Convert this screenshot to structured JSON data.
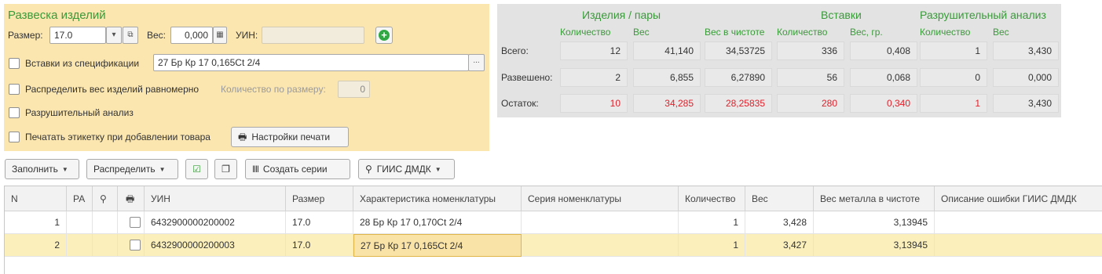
{
  "panel": {
    "title": "Развеска изделий",
    "size_label": "Размер:",
    "size_value": "17.0",
    "weight_label": "Вес:",
    "weight_value": "0,000",
    "uin_label": "УИН:",
    "uin_value": "",
    "inserts_label": "Вставки из спецификации",
    "inserts_value": "27 Бр Кр 17 0,165Ct 2/4",
    "browse_button": "...",
    "distribute_label": "Распределить вес изделий равномерно",
    "qty_by_size_label": "Количество по размеру:",
    "qty_by_size_value": "0",
    "destructive_label": "Разрушительный анализ",
    "print_label_label": "Печатать этикетку при добавлении товара",
    "print_settings_button": "Настройки печати"
  },
  "summary": {
    "group_items": "Изделия / пары",
    "group_inserts": "Вставки",
    "group_destructive": "Разрушительный анализ",
    "sub_qty": "Количество",
    "sub_weight": "Вес",
    "sub_pure": "Вес в чистоте",
    "sub_ins_qty": "Количество",
    "sub_ins_weight": "Вес, гр.",
    "sub_d_qty": "Количество",
    "sub_d_weight": "Вес",
    "rows": [
      {
        "label": "Всего:",
        "values": [
          "12",
          "41,140",
          "34,53725",
          "336",
          "0,408",
          "1",
          "3,430"
        ]
      },
      {
        "label": "Развешено:",
        "values": [
          "2",
          "6,855",
          "6,27890",
          "56",
          "0,068",
          "0",
          "0,000"
        ]
      },
      {
        "label": "Остаток:",
        "values": [
          "10",
          "34,285",
          "28,25835",
          "280",
          "0,340",
          "1",
          "3,430"
        ]
      }
    ],
    "colors": {
      "remainder": "#e0202a",
      "header": "#3a9a3a"
    }
  },
  "toolbar": {
    "fill": "Заполнить",
    "distribute": "Распределить",
    "create_series": "Создать серии",
    "giis": "ГИИС ДМДК"
  },
  "table": {
    "headers": [
      "N",
      "РА",
      "",
      "",
      "УИН",
      "Размер",
      "Характеристика номенклатуры",
      "Серия номенклатуры",
      "Количество",
      "Вес",
      "Вес металла в чистоте",
      "Описание ошибки ГИИС ДМДК"
    ],
    "rows": [
      {
        "n": "1",
        "uin": "6432900000200002",
        "size": "17.0",
        "characteristic": "28 Бр Кр 17 0,170Ct 2/4",
        "series": "",
        "qty": "1",
        "weight": "3,428",
        "pure": "3,13945",
        "error": ""
      },
      {
        "n": "2",
        "uin": "6432900000200003",
        "size": "17.0",
        "characteristic": "27 Бр Кр 17 0,165Ct 2/4",
        "series": "",
        "qty": "1",
        "weight": "3,427",
        "pure": "3,13945",
        "error": ""
      }
    ]
  }
}
